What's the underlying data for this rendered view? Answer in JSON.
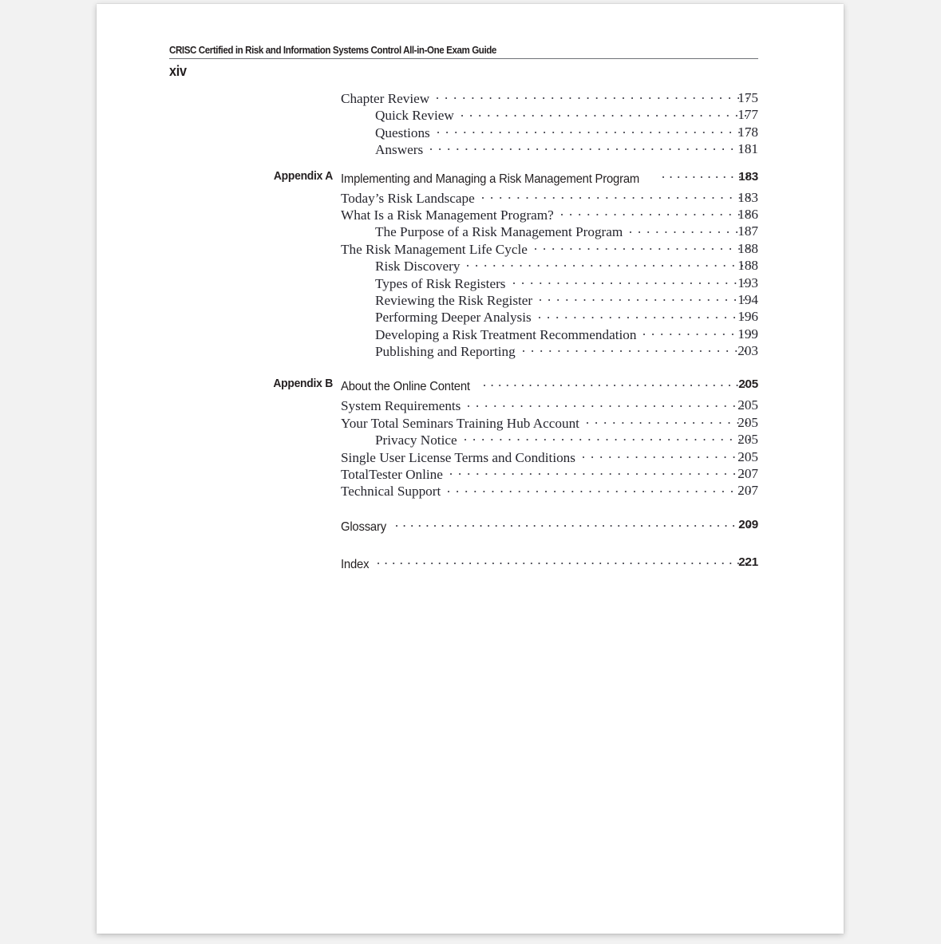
{
  "page": {
    "running_head": "CRISC Certified in Risk and Information Systems Control All-in-One Exam Guide",
    "folio": "xiv"
  },
  "toc": {
    "groups": [
      {
        "entries": [
          {
            "level": 1,
            "label": "",
            "title": "Chapter Review",
            "page": "175"
          },
          {
            "level": 2,
            "label": "",
            "title": "Quick Review",
            "page": "177"
          },
          {
            "level": 2,
            "label": "",
            "title": "Questions",
            "page": "178"
          },
          {
            "level": 2,
            "label": "",
            "title": "Answers",
            "page": "181"
          }
        ]
      },
      {
        "entries": [
          {
            "level": 0,
            "label": "Appendix A",
            "title": "Implementing and Managing a Risk Management Program",
            "page": "183"
          },
          {
            "level": 1,
            "label": "",
            "title": "Today’s Risk Landscape",
            "page": "183"
          },
          {
            "level": 1,
            "label": "",
            "title": "What Is a Risk Management Program?",
            "page": "186"
          },
          {
            "level": 2,
            "label": "",
            "title": "The Purpose of a Risk Management Program",
            "page": "187"
          },
          {
            "level": 1,
            "label": "",
            "title": "The Risk Management Life Cycle",
            "page": "188"
          },
          {
            "level": 2,
            "label": "",
            "title": "Risk Discovery",
            "page": "188"
          },
          {
            "level": 2,
            "label": "",
            "title": "Types of Risk Registers",
            "page": "193"
          },
          {
            "level": 2,
            "label": "",
            "title": "Reviewing the Risk Register",
            "page": "194"
          },
          {
            "level": 2,
            "label": "",
            "title": "Performing Deeper Analysis",
            "page": "196"
          },
          {
            "level": 2,
            "label": "",
            "title": "Developing a Risk Treatment Recommendation",
            "page": "199"
          },
          {
            "level": 2,
            "label": "",
            "title": "Publishing and Reporting",
            "page": "203"
          }
        ]
      },
      {
        "entries": [
          {
            "level": 0,
            "label": "Appendix B",
            "title": "About the Online Content",
            "page": "205"
          },
          {
            "level": 1,
            "label": "",
            "title": "System Requirements",
            "page": "205"
          },
          {
            "level": 1,
            "label": "",
            "title": "Your Total Seminars Training Hub Account",
            "page": "205"
          },
          {
            "level": 2,
            "label": "",
            "title": "Privacy Notice",
            "page": "205"
          },
          {
            "level": 1,
            "label": "",
            "title": "Single User License Terms and Conditions",
            "page": "205"
          },
          {
            "level": 1,
            "label": "",
            "title": "TotalTester Online",
            "page": "207"
          },
          {
            "level": 1,
            "label": "",
            "title": "Technical Support",
            "page": "207"
          }
        ]
      },
      {
        "entries": [
          {
            "level": 0,
            "label": "",
            "title": "Glossary",
            "page": "209"
          }
        ]
      },
      {
        "entries": [
          {
            "level": 0,
            "label": "",
            "title": "Index",
            "page": "221"
          }
        ]
      }
    ]
  },
  "colors": {
    "text": "#26262e",
    "heading": "#231f20",
    "rule": "#6f7176",
    "page_background": "#ffffff",
    "canvas_background": "#f2f2f2"
  }
}
